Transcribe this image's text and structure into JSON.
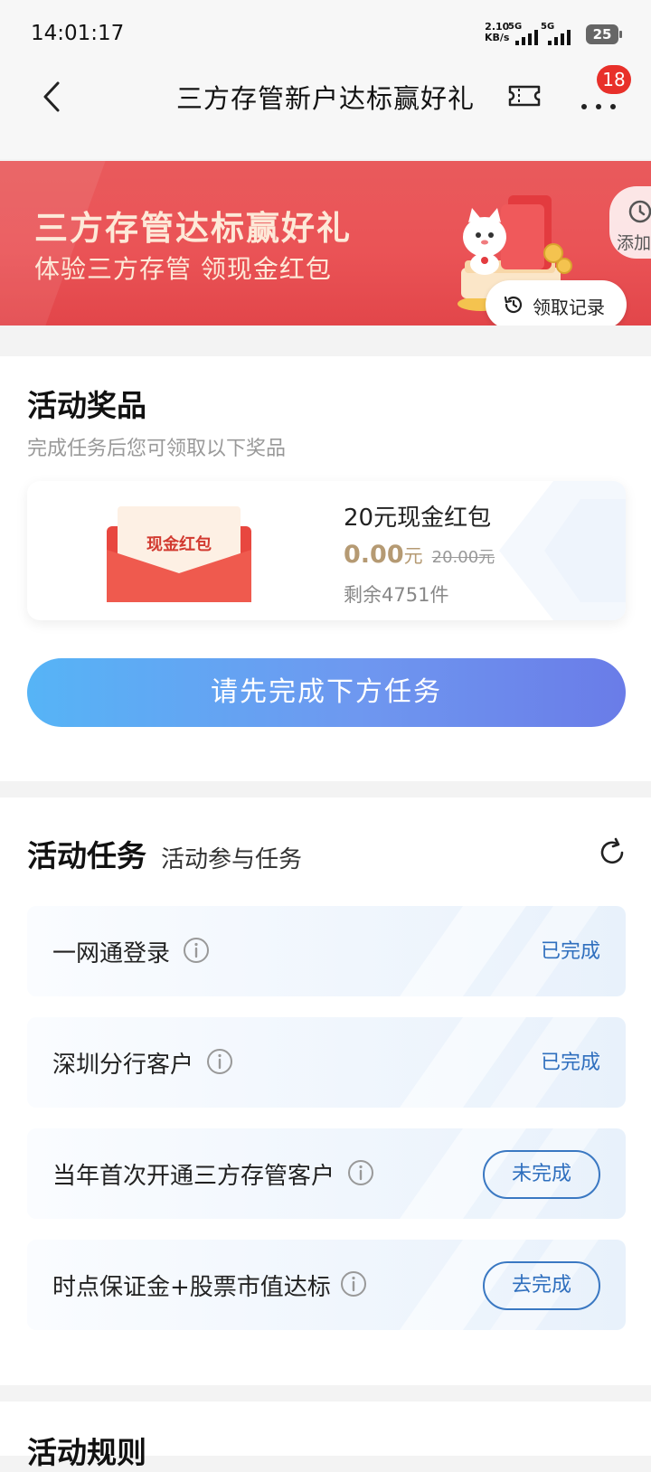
{
  "status_bar": {
    "time": "14:01:17",
    "net_speed_value": "2.10",
    "net_speed_unit": "KB/s",
    "sim1_tag": "5G",
    "sim2_tag": "5G",
    "battery": "25"
  },
  "header": {
    "title": "三方存管新户达标赢好礼",
    "badge_count": "18"
  },
  "banner": {
    "title": "三方存管达标赢好礼",
    "subtitle": "体验三方存管 领现金红包",
    "add_tab_label": "添加",
    "records_label": "领取记录"
  },
  "prize_section": {
    "title": "活动奖品",
    "description": "完成任务后您可领取以下奖品",
    "envelope_text": "现金红包",
    "prize_name": "20元现金红包",
    "price_now": "0.00",
    "price_unit": "元",
    "price_old": "20.00元",
    "stock": "剩余4751件",
    "cta_label": "请先完成下方任务"
  },
  "task_section": {
    "title": "活动任务",
    "subtitle": "活动参与任务",
    "tasks": [
      {
        "label": "一网通登录",
        "status": "已完成"
      },
      {
        "label": "深圳分行客户",
        "status": "已完成"
      },
      {
        "label": "当年首次开通三方存管客户",
        "status": "未完成"
      },
      {
        "label": "时点保证金+股票市值达标",
        "status": "去完成"
      }
    ]
  },
  "rules_section": {
    "title": "活动规则"
  },
  "colors": {
    "banner_red": "#ea5356",
    "link_blue": "#2f6fbe",
    "price_gold": "#b59a73",
    "cta_gradient_start": "#56b4f6",
    "cta_gradient_end": "#6a7ce8",
    "badge_red": "#e8302a"
  }
}
